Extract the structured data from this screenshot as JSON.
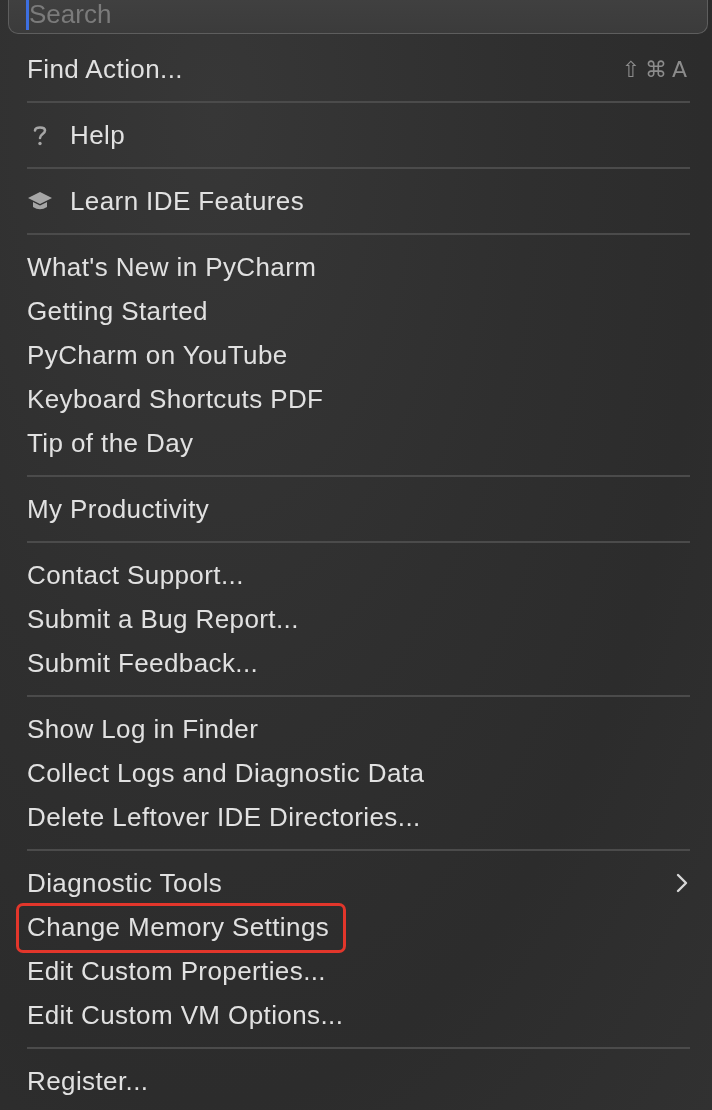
{
  "search": {
    "placeholder": "Search",
    "focused": true
  },
  "sections": [
    {
      "items": [
        {
          "label": "Find Action...",
          "kind": "plain",
          "shortcut": "⇧⌘A",
          "highlighted": false
        }
      ]
    },
    {
      "items": [
        {
          "label": "Help",
          "kind": "help",
          "highlighted": false
        }
      ]
    },
    {
      "items": [
        {
          "label": "Learn IDE Features",
          "kind": "learn",
          "highlighted": false
        }
      ]
    },
    {
      "items": [
        {
          "label": "What's New in PyCharm",
          "kind": "plain",
          "highlighted": false
        },
        {
          "label": "Getting Started",
          "kind": "plain",
          "highlighted": false
        },
        {
          "label": "PyCharm on YouTube",
          "kind": "plain",
          "highlighted": false
        },
        {
          "label": "Keyboard Shortcuts PDF",
          "kind": "plain",
          "highlighted": false
        },
        {
          "label": "Tip of the Day",
          "kind": "plain",
          "highlighted": false
        }
      ]
    },
    {
      "items": [
        {
          "label": "My Productivity",
          "kind": "plain",
          "highlighted": false
        }
      ]
    },
    {
      "items": [
        {
          "label": "Contact Support...",
          "kind": "plain",
          "highlighted": false
        },
        {
          "label": "Submit a Bug Report...",
          "kind": "plain",
          "highlighted": false
        },
        {
          "label": "Submit Feedback...",
          "kind": "plain",
          "highlighted": false
        }
      ]
    },
    {
      "items": [
        {
          "label": "Show Log in Finder",
          "kind": "plain",
          "highlighted": false
        },
        {
          "label": "Collect Logs and Diagnostic Data",
          "kind": "plain",
          "highlighted": false
        },
        {
          "label": "Delete Leftover IDE Directories...",
          "kind": "plain",
          "highlighted": false
        }
      ]
    },
    {
      "items": [
        {
          "label": "Diagnostic Tools",
          "kind": "submenu",
          "highlighted": false
        },
        {
          "label": "Change Memory Settings",
          "kind": "plain",
          "highlighted": true
        },
        {
          "label": "Edit Custom Properties...",
          "kind": "plain",
          "highlighted": false
        },
        {
          "label": "Edit Custom VM Options...",
          "kind": "plain",
          "highlighted": false
        }
      ]
    },
    {
      "items": [
        {
          "label": "Register...",
          "kind": "plain",
          "highlighted": false
        }
      ]
    }
  ]
}
